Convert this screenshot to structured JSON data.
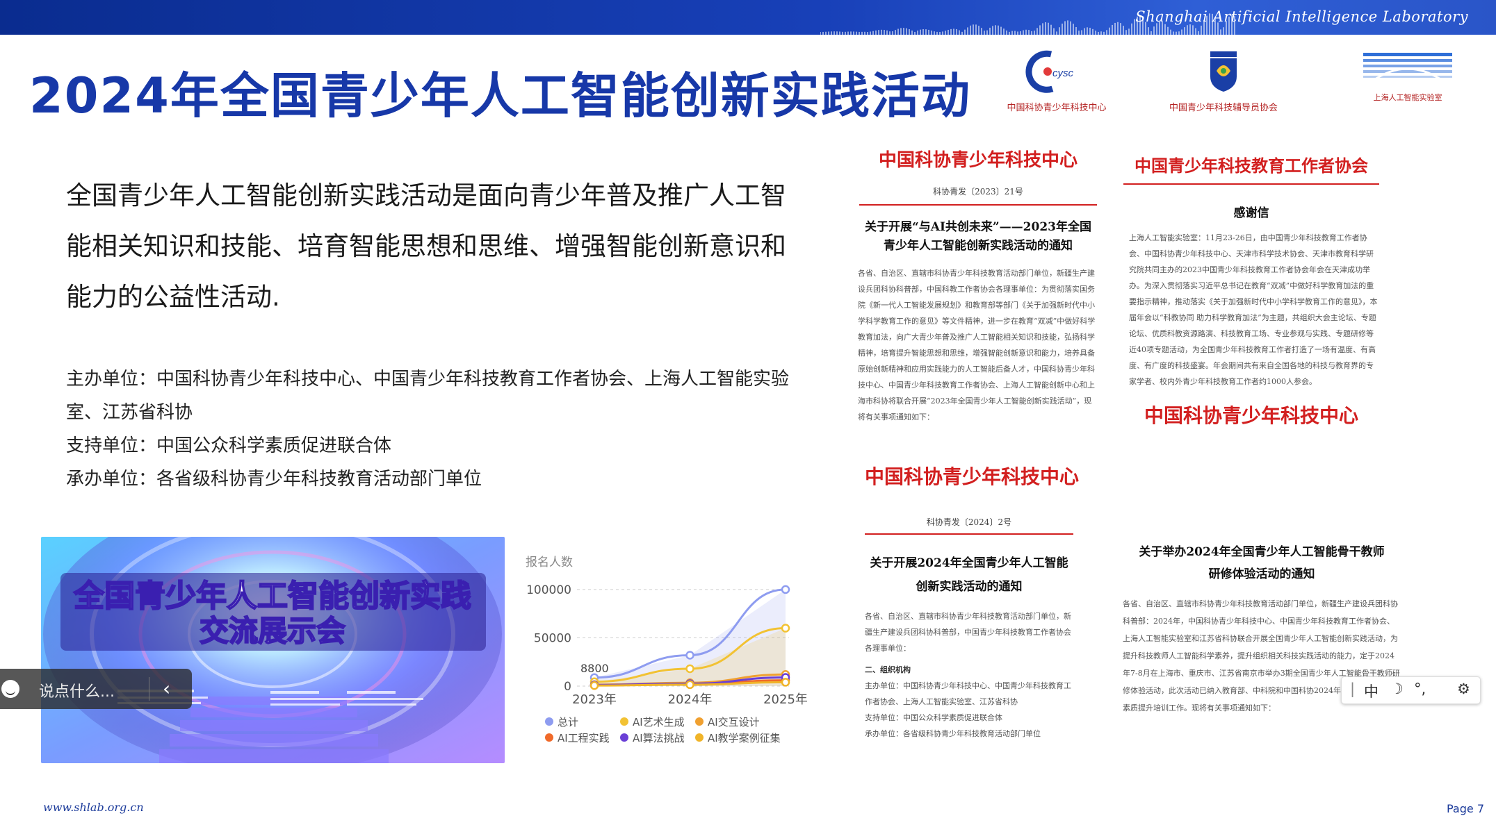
{
  "header": {
    "lab_name": "Shanghai Artificial Intelligence Laboratory"
  },
  "title": "2024年全国青少年人工智能创新实践活动",
  "logos": [
    {
      "icon": "cysc-logo-icon",
      "caption": "中国科协青少年科技中心"
    },
    {
      "icon": "shield-logo-icon",
      "caption": "中国青少年科技辅导员协会"
    },
    {
      "icon": "shlab-logo-icon",
      "caption": "上海人工智能实验室"
    }
  ],
  "intro": "全国青少年人工智能创新实践活动是面向青少年普及推广人工智能相关知识和技能、培育智能思想和思维、增强智能创新意识和能力的公益性活动.",
  "units": [
    "主办单位：中国科协青少年科技中心、中国青少年科技教育工作者协会、上海人工智能实验室、江苏省科协",
    "支持单位：中国公众科学素质促进联合体",
    "承办单位：各省级科协青少年科技教育活动部门单位"
  ],
  "banner": {
    "title_line1": "全国青少年人工智能创新实践",
    "title_line2": "交流展示会"
  },
  "chat": {
    "placeholder": "说点什么..."
  },
  "chart_data": {
    "type": "line",
    "ylabel": "报名人数",
    "x": [
      "2023年",
      "2024年",
      "2025年"
    ],
    "yticks": [
      0,
      50000,
      100000
    ],
    "ylim": [
      0,
      110000
    ],
    "annotation": "8800",
    "series": [
      {
        "name": "总计",
        "color": "#8e9cf0",
        "values": [
          8800,
          32000,
          100000
        ]
      },
      {
        "name": "AI艺术生成",
        "color": "#f2c233",
        "values": [
          4500,
          18000,
          60000
        ]
      },
      {
        "name": "AI交互设计",
        "color": "#f0a030",
        "values": [
          1500,
          3500,
          12000
        ]
      },
      {
        "name": "AI工程实践",
        "color": "#f06a2a",
        "values": [
          800,
          2000,
          6000
        ]
      },
      {
        "name": "AI算法挑战",
        "color": "#6a3fd6",
        "values": [
          1200,
          2500,
          9000
        ]
      },
      {
        "name": "AI教学案例征集",
        "color": "#f0b429",
        "values": [
          600,
          1500,
          4000
        ]
      }
    ]
  },
  "docs": {
    "d1": {
      "org": "中国科协青少年科技中心",
      "no": "科协青发〔2023〕21号",
      "head": "关于开展“与AI共创未来”——2023年全国青少年人工智能创新实践活动的通知",
      "body": "各省、自治区、直辖市科协青少年科技教育活动部门单位，新疆生产建设兵团科协科普部，中国科教工作者协会各理事单位：为贯彻落实国务院《新一代人工智能发展规划》和教育部等部门《关于加强新时代中小学科学教育工作的意见》等文件精神，进一步在教育“双减”中做好科学教育加法，向广大青少年普及推广人工智能相关知识和技能，弘扬科学精神，培育提升智能思想和思维，增强智能创新意识和能力，培养具备原始创新精神和应用实践能力的人工智能后备人才，中国科协青少年科技中心、中国青少年科技教育工作者协会、上海人工智能创新中心和上海市科协将联合开展“2023年全国青少年人工智能创新实践活动”，现将有关事项通知如下："
    },
    "d2": {
      "org": "中国青少年科技教育工作者协会",
      "head": "感谢信",
      "body": "上海人工智能实验室：11月23-26日，由中国青少年科技教育工作者协会、中国科协青少年科技中心、天津市科学技术协会、天津市教育科学研究院共同主办的2023中国青少年科技教育工作者协会年会在天津成功举办。为深入贯彻落实习近平总书记在教育“双减”中做好科学教育加法的重要指示精神，推动落实《关于加强新时代中小学科学教育工作的意见》，本届年会以“科教协同 助力科学教育加法”为主题，共组织大会主论坛、专题论坛、优质科教资源路演、科技教育工场、专业参观与实践、专题研修等近40项专题活动，为全国青少年科技教育工作者打造了一场有温度、有高度、有广度的科技盛宴。年会期间共有来自全国各地的科技与教育界的专家学者、校内外青少年科技教育工作者约1000人参会。",
      "org2": "中国科协青少年科技中心"
    },
    "d3": {
      "org": "中国科协青少年科技中心",
      "no": "科协青发〔2024〕2号",
      "head": "关于开展2024年全国青少年人工智能创新实践活动的通知",
      "body": "各省、自治区、直辖市科协青少年科技教育活动部门单位，新疆生产建设兵团科协科普部，中国青少年科技教育工作者协会各理事单位：",
      "section": "二、组织机构",
      "lines": [
        "主办单位：中国科协青少年科技中心、中国青少年科技教育工作者协会、上海人工智能实验室、江苏省科协",
        "支持单位：中国公众科学素质促进联合体",
        "承办单位：各省级科协青少年科技教育活动部门单位"
      ]
    },
    "d4": {
      "head": "关于举办2024年全国青少年人工智能骨干教师研修体验活动的通知",
      "body": "各省、自治区、直辖市科协青少年科技教育活动部门单位，新疆生产建设兵团科协科普部：2024年，中国科协青少年科技中心、中国青少年科技教育工作者协会、上海人工智能实验室和江苏省科协联合开展全国青少年人工智能创新实践活动，为提升科技教师人工智能科学素养，提升组织相关科技实践活动的能力，定于2024年7-8月在上海市、重庆市、江苏省南京市举办3期全国青少年人工智能骨干教师研修体验活动，此次活动已纳入教育部、中科院和中国科协2024年中小学教师科学素质提升培训工作。现将有关事项通知如下："
    }
  },
  "ime": {
    "zh": "中"
  },
  "footer": {
    "url": "www.shlab.org.cn",
    "page": "Page 7"
  }
}
